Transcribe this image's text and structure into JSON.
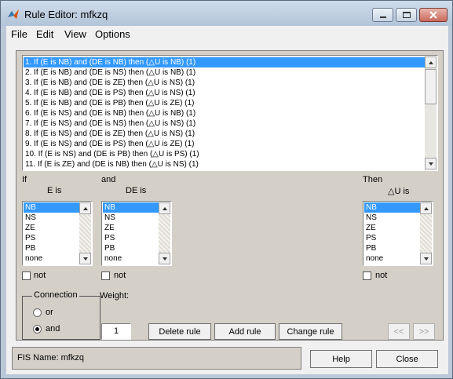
{
  "window": {
    "title": "Rule Editor: mfkzq"
  },
  "menu": [
    "File",
    "Edit",
    "View",
    "Options"
  ],
  "rules": [
    "1. If (E is NB) and (DE is NB) then (△U is NB) (1)",
    "2. If (E is NB) and (DE is NS) then (△U is NB) (1)",
    "3. If (E is NB) and (DE is ZE) then (△U is NS) (1)",
    "4. If (E is NB) and (DE is PS) then (△U is NS) (1)",
    "5. If (E is NB) and (DE is PB) then (△U is ZE) (1)",
    "6. If (E is NS) and (DE is NB) then (△U is NB) (1)",
    "7. If (E is NS) and (DE is NS) then (△U is NS) (1)",
    "8. If (E is NS) and (DE is ZE) then (△U is NS) (1)",
    "9. If (E is NS) and (DE is PS) then (△U is ZE) (1)",
    "10. If (E is NS) and (DE is PB) then (△U is PS) (1)",
    "11. If (E is ZE) and (DE is NB) then (△U is NS) (1)"
  ],
  "if_label": "If",
  "and_label": "and",
  "then_label": "Then",
  "inputs": {
    "e": {
      "label": "E is",
      "items": [
        "NB",
        "NS",
        "ZE",
        "PS",
        "PB",
        "none"
      ]
    },
    "de": {
      "label": "DE is",
      "items": [
        "NB",
        "NS",
        "ZE",
        "PS",
        "PB",
        "none"
      ]
    }
  },
  "output": {
    "u": {
      "label": "△U is",
      "items": [
        "NB",
        "NS",
        "ZE",
        "PS",
        "PB",
        "none"
      ]
    }
  },
  "not_label": "not",
  "connection": {
    "title": "Connection",
    "or": "or",
    "and": "and"
  },
  "weight": {
    "label": "Weight:",
    "value": "1"
  },
  "buttons": {
    "delete": "Delete rule",
    "add": "Add rule",
    "change": "Change rule",
    "prev": "<<",
    "next": ">>",
    "help": "Help",
    "close": "Close"
  },
  "status": "FIS Name: mfkzq",
  "colors": {
    "selection": "#3399ff",
    "panel": "#d4d0c8",
    "frame": "#bac8d8"
  }
}
